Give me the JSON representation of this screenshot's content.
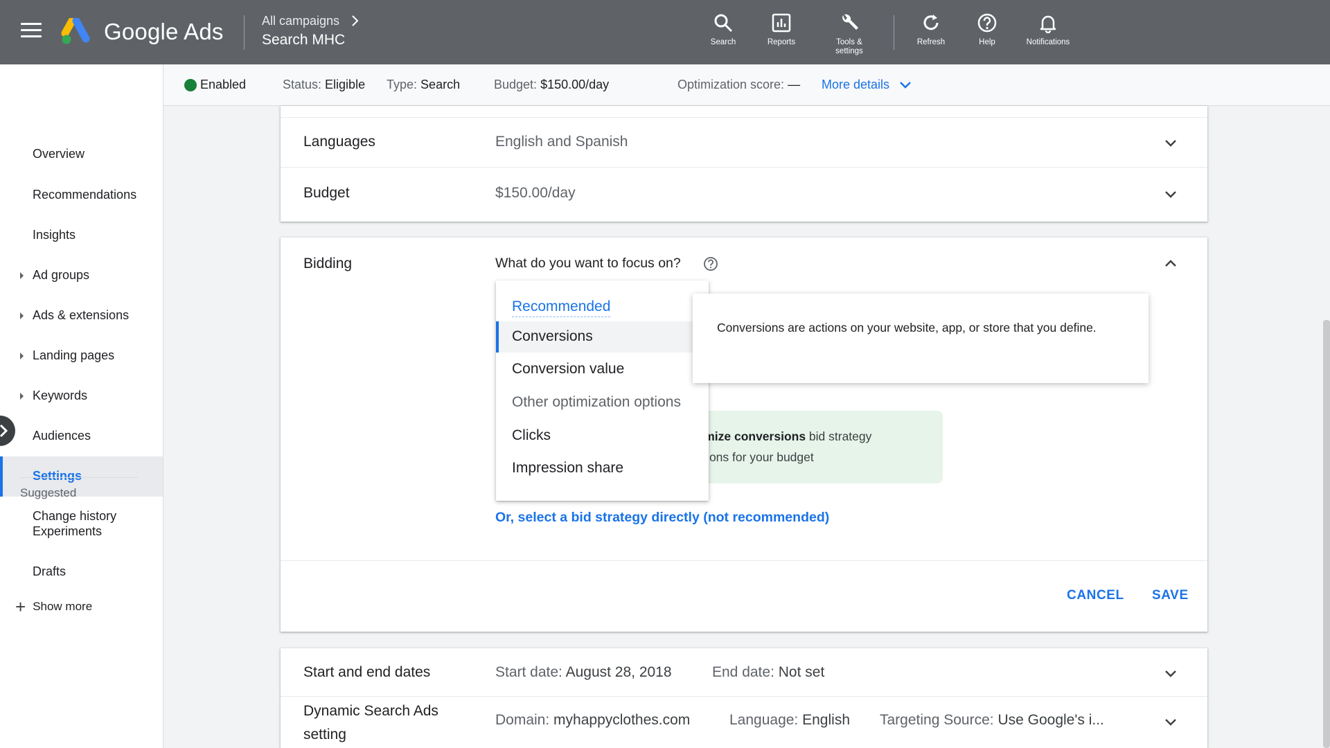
{
  "app": {
    "brand": "Google Ads",
    "breadcrumb_parent": "All campaigns",
    "campaign_name": "Search MHC"
  },
  "toolbar": {
    "search": "Search",
    "reports": "Reports",
    "tools_line1": "Tools &",
    "tools_line2": "settings",
    "refresh": "Refresh",
    "help": "Help",
    "notifications": "Notifications"
  },
  "status_bar": {
    "state": "Enabled",
    "status_label": "Status:",
    "status_value": "Eligible",
    "type_label": "Type:",
    "type_value": "Search",
    "budget_label": "Budget:",
    "budget_value": "$150.00/day",
    "opt_label": "Optimization score:",
    "opt_value": "—",
    "more_details": "More details"
  },
  "sidebar": {
    "items": [
      {
        "label": "Overview"
      },
      {
        "label": "Recommendations"
      },
      {
        "label": "Insights"
      },
      {
        "label": "Ad groups"
      },
      {
        "label": "Ads & extensions"
      },
      {
        "label": "Landing pages"
      },
      {
        "label": "Keywords"
      },
      {
        "label": "Audiences"
      },
      {
        "label": "Settings"
      },
      {
        "label": "Change history"
      }
    ],
    "suggested_header": "Suggested",
    "suggested_items": [
      {
        "label": "Experiments"
      },
      {
        "label": "Drafts"
      }
    ],
    "show_more": "Show more",
    "active": "Settings"
  },
  "settings": {
    "languages_label": "Languages",
    "languages_value": "English and Spanish",
    "budget_label": "Budget",
    "budget_value": "$150.00/day",
    "bidding": {
      "label": "Bidding",
      "question": "What do you want to focus on?",
      "green_bold": "laximize conversions",
      "green_rest": " bid strategy",
      "green_line2": "versions for your budget",
      "select_link": "Or, select a bid strategy directly (not recommended)",
      "cancel": "CANCEL",
      "save": "SAVE"
    },
    "dates_label": "Start and end dates",
    "start_label": "Start date:",
    "start_value": "August 28, 2018",
    "end_label": "End date:",
    "end_value": "Not set",
    "dsa_label_line1": "Dynamic Search Ads",
    "dsa_label_line2": "setting",
    "domain_label": "Domain:",
    "domain_value": "myhappyclothes.com",
    "language_label": "Language:",
    "language_value": "English",
    "source_label": "Targeting Source:",
    "source_value": "Use Google's i..."
  },
  "dropdown": {
    "header": "Recommended",
    "options": [
      "Conversions",
      "Conversion value"
    ],
    "sub_header": "Other optimization options",
    "other_options": [
      "Clicks",
      "Impression share"
    ],
    "selected": "Conversions"
  },
  "tooltip": {
    "text": "Conversions are actions on your website, app, or store that you define."
  },
  "colors": {
    "topbar": "#5f6368",
    "accent": "#1a73e8",
    "enabled": "#188038",
    "green_box": "#e6f4ea"
  }
}
